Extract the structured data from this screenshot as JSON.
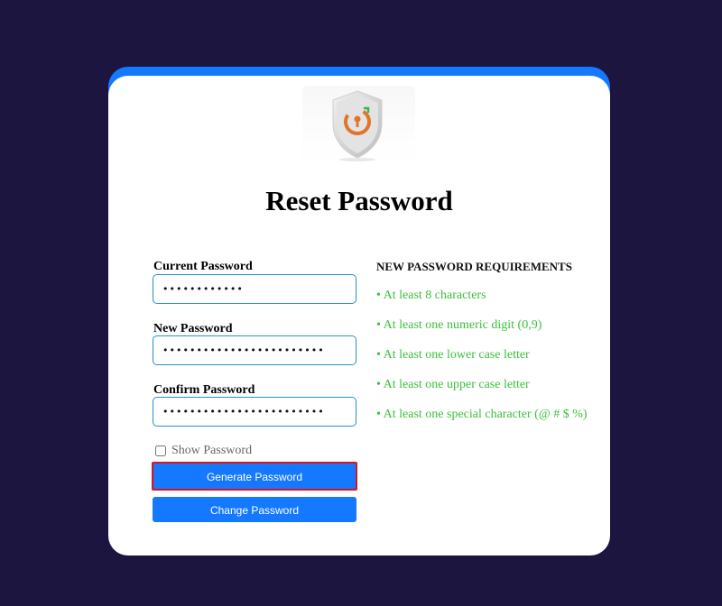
{
  "page": {
    "title": "Reset Password"
  },
  "logo": {
    "icon": "shield-lock-icon"
  },
  "form": {
    "current": {
      "label": "Current Password",
      "value": "••••••••••••"
    },
    "new": {
      "label": "New Password",
      "value": "••••••••••••••••••••••••"
    },
    "confirm": {
      "label": "Confirm Password",
      "value": "••••••••••••••••••••••••"
    },
    "show_password_label": "Show Password",
    "show_password_checked": false,
    "generate_label": "Generate Password",
    "change_label": "Change Password"
  },
  "requirements": {
    "title": "NEW PASSWORD REQUIREMENTS",
    "items": [
      "• At least 8 characters",
      "• At least one numeric digit (0,9)",
      "• At least one lower case letter",
      "• At least one upper case letter",
      "• At least one special character (@ # $ %)"
    ]
  },
  "colors": {
    "background": "#1b1540",
    "accent": "#1479ff",
    "requirement_text": "#3cbf3c",
    "highlight_border": "#e0111f"
  }
}
